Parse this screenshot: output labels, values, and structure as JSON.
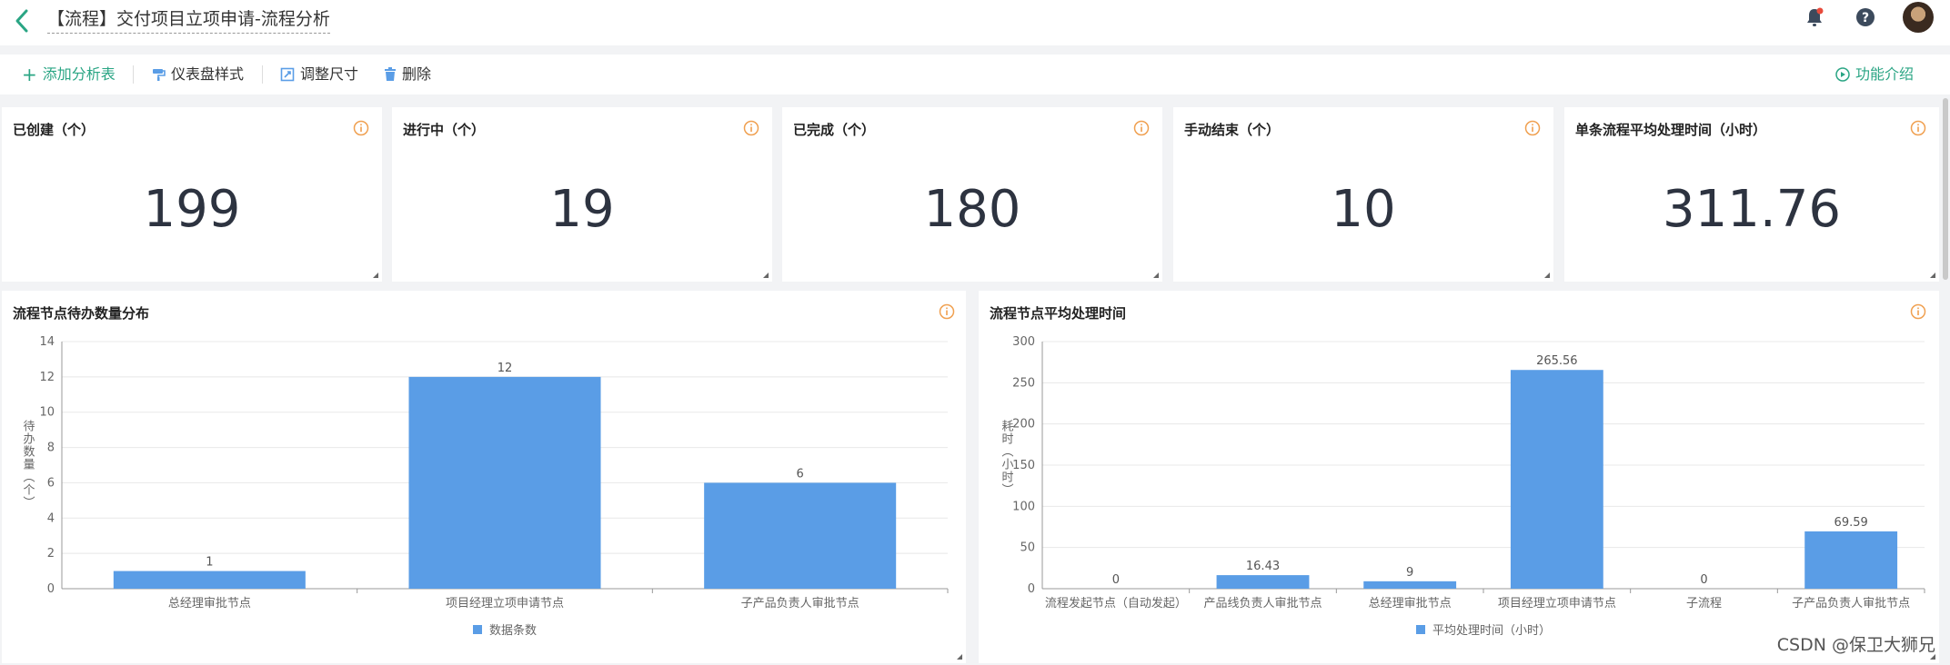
{
  "header": {
    "title": "【流程】交付项目立项申请-流程分析",
    "icons": [
      "back-icon",
      "bell-icon",
      "help-icon",
      "avatar"
    ]
  },
  "toolbar": {
    "add_label": "添加分析表",
    "style_label": "仪表盘样式",
    "resize_label": "调整尺寸",
    "delete_label": "删除",
    "intro_label": "功能介绍"
  },
  "kpis": [
    {
      "title": "已创建（个）",
      "value": "199"
    },
    {
      "title": "进行中（个）",
      "value": "19"
    },
    {
      "title": "已完成（个）",
      "value": "180"
    },
    {
      "title": "手动结束（个）",
      "value": "10"
    },
    {
      "title": "单条流程平均处理时间（小时）",
      "value": "311.76"
    }
  ],
  "colors": {
    "accent": "#2aa584",
    "bar": "#5a9de6",
    "info": "#f0a050"
  },
  "chart_data": [
    {
      "type": "bar",
      "title": "流程节点待办数量分布",
      "ylabel": "待办数量（个）",
      "categories": [
        "总经理审批节点",
        "项目经理立项申请节点",
        "子产品负责人审批节点"
      ],
      "series": [
        {
          "name": "数据条数",
          "values": [
            1,
            12,
            6
          ]
        }
      ],
      "ylim": [
        0,
        14
      ],
      "yticks": [
        0,
        2,
        4,
        6,
        8,
        10,
        12,
        14
      ],
      "grid": true,
      "legend": "bottom"
    },
    {
      "type": "bar",
      "title": "流程节点平均处理时间",
      "ylabel": "耗时（小时）",
      "categories": [
        "流程发起节点（自动发起）",
        "产品线负责人审批节点",
        "总经理审批节点",
        "项目经理立项申请节点",
        "子流程",
        "子产品负责人审批节点"
      ],
      "series": [
        {
          "name": "平均处理时间（小时）",
          "values": [
            0,
            16.43,
            9,
            265.56,
            0,
            69.59
          ]
        }
      ],
      "ylim": [
        0,
        300
      ],
      "yticks": [
        0,
        50,
        100,
        150,
        200,
        250,
        300
      ],
      "grid": true,
      "legend": "bottom"
    }
  ],
  "watermark": "CSDN @保卫大狮兄"
}
